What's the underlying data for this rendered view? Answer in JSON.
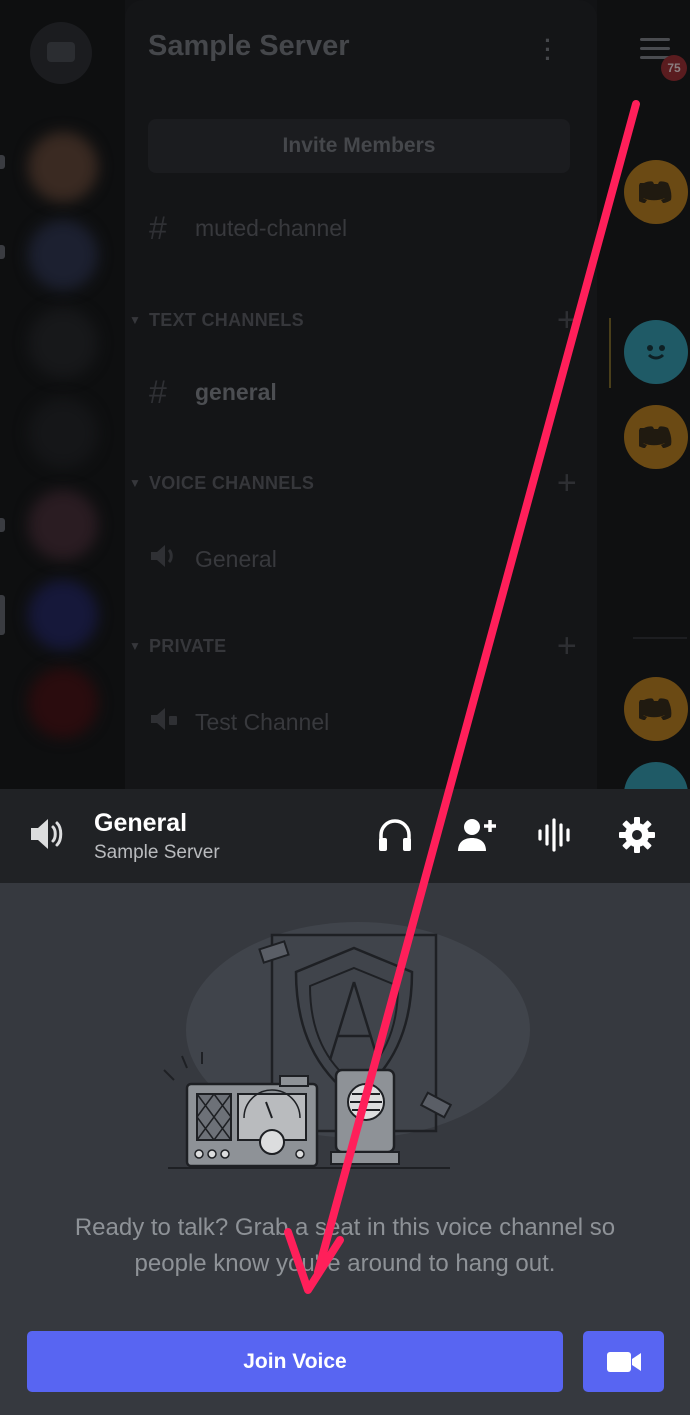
{
  "server": {
    "name": "Sample Server",
    "invite_label": "Invite Members",
    "muted_channel": "muted-channel",
    "categories": [
      {
        "label": "TEXT CHANNELS",
        "channels": [
          "general"
        ]
      },
      {
        "label": "VOICE CHANNELS",
        "channels": [
          "General"
        ]
      },
      {
        "label": "PRIVATE",
        "channels": [
          "Test Channel"
        ]
      }
    ]
  },
  "members_rail": {
    "notification_count": "75"
  },
  "voice_panel": {
    "channel_name": "General",
    "server_name": "Sample Server",
    "prompt": "Ready to talk? Grab a seat in this voice channel so people know you're around to hang out.",
    "join_label": "Join Voice"
  },
  "colors": {
    "blurple": "#5865f2",
    "annotation_arrow": "#ff1f5a",
    "sheet_bg": "#36393f",
    "header_bg": "#202225"
  },
  "icons": {
    "speaker": "speaker-icon",
    "headphones": "headphones-icon",
    "add_user": "add-user-icon",
    "audio_wave": "audio-wave-icon",
    "settings": "gear-icon",
    "video": "video-camera-icon"
  }
}
